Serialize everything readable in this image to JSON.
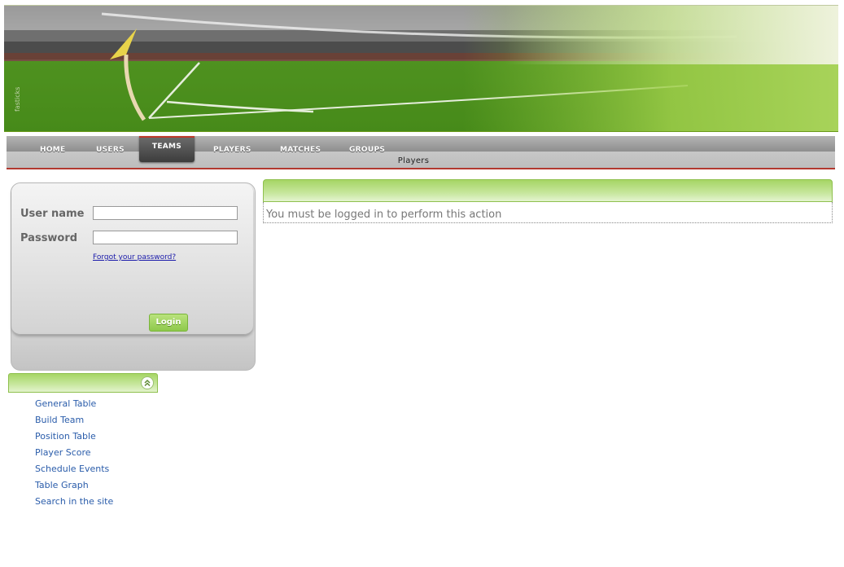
{
  "nav": {
    "items": [
      {
        "label": "HOME"
      },
      {
        "label": "USERS"
      },
      {
        "label": "TEAMS"
      },
      {
        "label": "PLAYERS"
      },
      {
        "label": "MATCHES"
      },
      {
        "label": "GROUPS"
      }
    ],
    "active": "TEAMS",
    "submenu_label": "Players"
  },
  "login": {
    "username_label": "User name",
    "password_label": "Password",
    "username_value": "",
    "password_value": "",
    "forgot_link": "Forgot your password?",
    "login_button": "Login"
  },
  "sidebar": {
    "collapse_icon": "double-chevron-up-icon",
    "items": [
      {
        "label": "General Table"
      },
      {
        "label": "Build Team"
      },
      {
        "label": "Position Table"
      },
      {
        "label": "Player Score"
      },
      {
        "label": "Schedule Events"
      },
      {
        "label": "Table Graph"
      },
      {
        "label": "Search in the site"
      }
    ]
  },
  "main": {
    "message": "You must be logged in to perform this action"
  },
  "banner": {
    "watermark": "fasticks"
  },
  "colors": {
    "accent_green": "#9ccf5a",
    "nav_gray": "#9d9d9d",
    "nav_red_line": "#b2382f",
    "link_blue": "#2a5caa"
  }
}
